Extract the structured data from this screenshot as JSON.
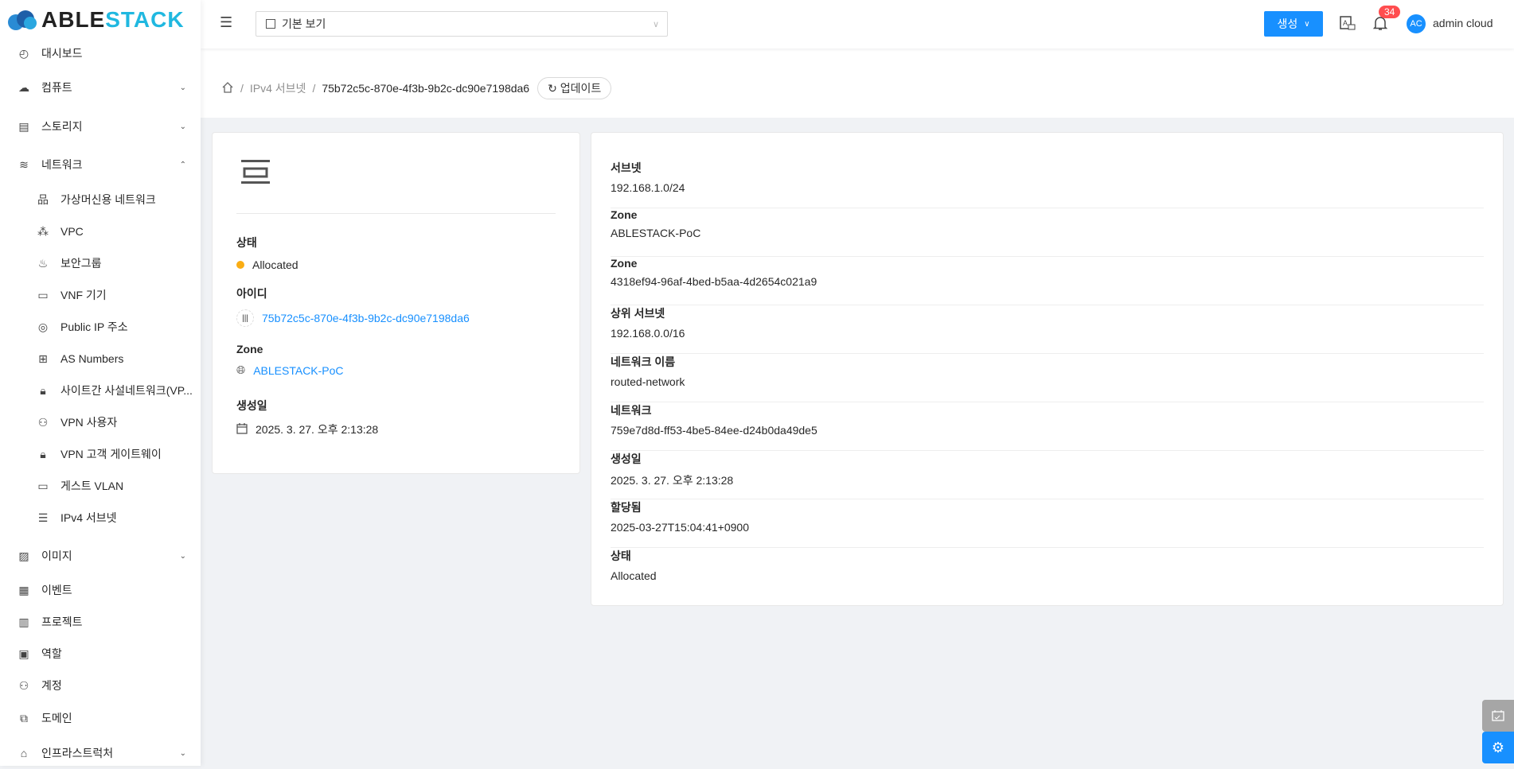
{
  "logo": {
    "part1": "ABLE",
    "part2": "STACK"
  },
  "sidebar": {
    "items": [
      {
        "label": "대시보드",
        "icon": "dashboard-icon"
      },
      {
        "label": "컴퓨트",
        "icon": "cloud-icon",
        "chev": "⌄"
      },
      {
        "label": "스토리지",
        "icon": "database-icon",
        "chev": "⌄"
      },
      {
        "label": "네트워크",
        "icon": "wifi-icon",
        "chev": "⌃"
      },
      {
        "label": "가상머신용 네트워크",
        "icon": "apartment-icon",
        "sub": true
      },
      {
        "label": "VPC",
        "icon": "deployment-unit-icon",
        "sub": true
      },
      {
        "label": "보안그룹",
        "icon": "fire-icon",
        "sub": true
      },
      {
        "label": "VNF 기기",
        "icon": "gateway-icon",
        "sub": true
      },
      {
        "label": "Public IP 주소",
        "icon": "environment-icon",
        "sub": true
      },
      {
        "label": "AS Numbers",
        "icon": "partition-icon",
        "sub": true
      },
      {
        "label": "사이트간 사설네트워크(VP...",
        "icon": "lock-icon",
        "sub": true
      },
      {
        "label": "VPN 사용자",
        "icon": "user-switch-icon",
        "sub": true
      },
      {
        "label": "VPN 고객 게이트웨이",
        "icon": "lock-icon",
        "sub": true
      },
      {
        "label": "게스트 VLAN",
        "icon": "folder-icon",
        "sub": true
      },
      {
        "label": "IPv4 서브넷",
        "icon": "subnet-icon",
        "sub": true
      },
      {
        "label": "이미지",
        "icon": "picture-icon",
        "chev": "⌄"
      },
      {
        "label": "이벤트",
        "icon": "schedule-icon"
      },
      {
        "label": "프로젝트",
        "icon": "project-icon"
      },
      {
        "label": "역할",
        "icon": "idcard-icon"
      },
      {
        "label": "계정",
        "icon": "team-icon"
      },
      {
        "label": "도메인",
        "icon": "block-icon"
      },
      {
        "label": "인프라스트럭처",
        "icon": "bank-icon",
        "chev": "⌄"
      }
    ]
  },
  "header": {
    "view_select": "기본 보기",
    "create": "생성",
    "notifications": "34",
    "avatar": "AC",
    "user": "admin cloud"
  },
  "breadcrumb": {
    "section": "IPv4 서브넷",
    "current": "75b72c5c-870e-4f3b-9b2c-dc90e7198da6",
    "refresh": "업데이트"
  },
  "left": {
    "state_label": "상태",
    "state": "Allocated",
    "id_label": "아이디",
    "id": "75b72c5c-870e-4f3b-9b2c-dc90e7198da6",
    "zone_label": "Zone",
    "zone": "ABLESTACK-PoC",
    "created_label": "생성일",
    "created": "2025. 3. 27. 오후 2:13:28"
  },
  "details": [
    {
      "label": "서브넷",
      "value": "192.168.1.0/24"
    },
    {
      "label": "Zone",
      "value": "ABLESTACK-PoC"
    },
    {
      "label": "Zone",
      "value": "4318ef94-96af-4bed-b5aa-4d2654c021a9"
    },
    {
      "label": "상위 서브넷",
      "value": "192.168.0.0/16"
    },
    {
      "label": "네트워크 이름",
      "value": "routed-network"
    },
    {
      "label": "네트워크",
      "value": "759e7d8d-ff53-4be5-84ee-d24b0da49de5"
    },
    {
      "label": "생성일",
      "value": "2025. 3. 27. 오후 2:13:28"
    },
    {
      "label": "할당됨",
      "value": "2025-03-27T15:04:41+0900"
    },
    {
      "label": "상태",
      "value": "Allocated"
    }
  ],
  "colors": {
    "primary": "#1890ff",
    "allocated": "#faad14",
    "badge": "#ff4d4f"
  }
}
